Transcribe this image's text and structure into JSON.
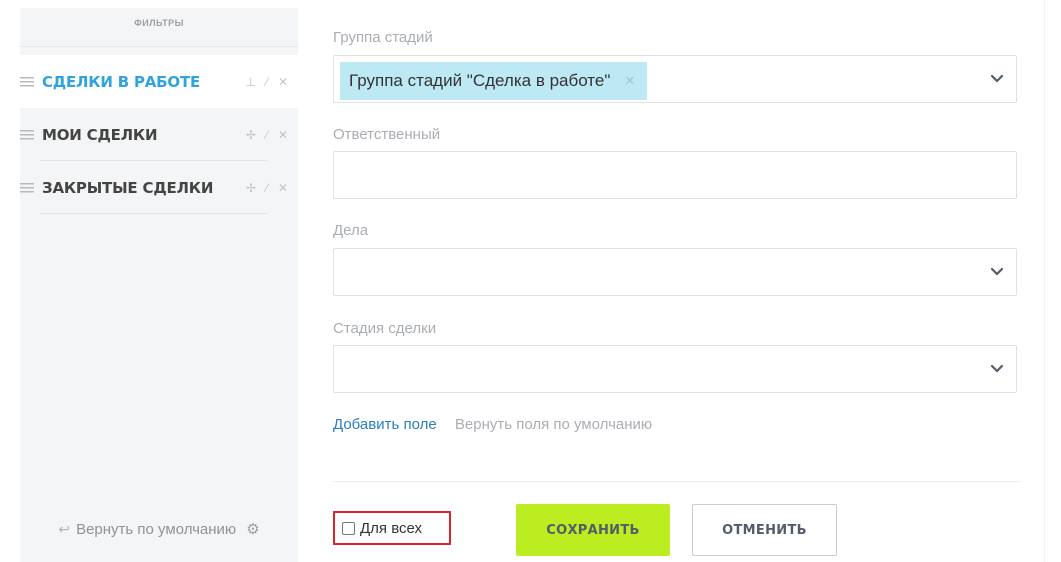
{
  "sidebar": {
    "title": "ФИЛЬТРЫ",
    "items": [
      {
        "label": "СДЕЛКИ В РАБОТЕ",
        "active": true
      },
      {
        "label": "МОИ СДЕЛКИ",
        "active": false
      },
      {
        "label": "ЗАКРЫТЫЕ СДЕЛКИ",
        "active": false
      }
    ],
    "footer": "Вернуть по умолчанию"
  },
  "form": {
    "fields": [
      {
        "label": "Группа стадий",
        "tag": "Группа стадий \"Сделка в работе\""
      },
      {
        "label": "Ответственный"
      },
      {
        "label": "Дела"
      },
      {
        "label": "Стадия сделки"
      }
    ],
    "add_field": "Добавить поле",
    "reset_fields": "Вернуть поля по умолчанию",
    "for_all": "Для всех",
    "save": "СОХРАНИТЬ",
    "cancel": "ОТМЕНИТЬ"
  },
  "colors": {
    "accent": "#2fa4dc",
    "save_button": "#bbed21",
    "tag_bg": "#bde9f5",
    "highlight": "#d9252b"
  }
}
